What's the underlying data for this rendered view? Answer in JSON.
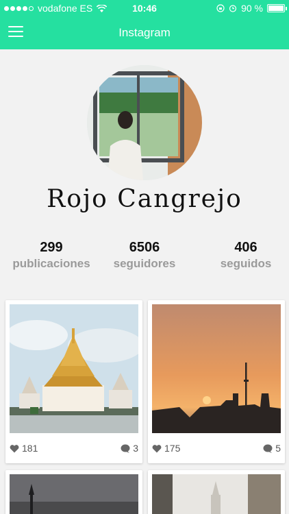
{
  "status_bar": {
    "carrier": "vodafone ES",
    "time": "10:46",
    "battery": "90 %",
    "battery_level": 0.9
  },
  "nav": {
    "title": "Instagram",
    "menu_icon": "hamburger-menu-icon"
  },
  "profile": {
    "name": "Rojo Cangrejo"
  },
  "stats": [
    {
      "value": "299",
      "label": "publicaciones"
    },
    {
      "value": "6506",
      "label": "seguidores"
    },
    {
      "value": "406",
      "label": "seguidos"
    }
  ],
  "posts": [
    {
      "likes": "181",
      "comments": "3"
    },
    {
      "likes": "175",
      "comments": "5"
    }
  ],
  "colors": {
    "accent": "#25e0a0",
    "background": "#f2f2f2",
    "stat_label": "#9a9a9a"
  }
}
